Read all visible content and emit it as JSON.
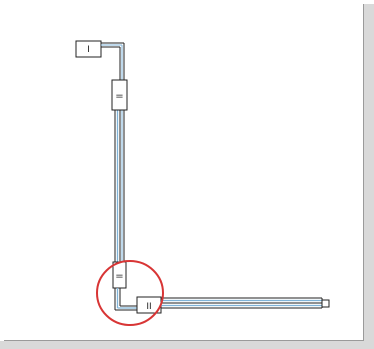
{
  "diagram": {
    "marks": {
      "top_block": "I",
      "upper_coupler": "=",
      "lower_coupler": "=",
      "elbow_block": "II"
    }
  },
  "colors": {
    "pipe_outline": "#222222",
    "pipe_inner": "#7fb3d8",
    "highlight_circle": "#d83535",
    "page_shadow": "#9a9a9a",
    "background": "#ffffff"
  },
  "icons": {
    "highlight": "red-ellipse-annotation"
  }
}
